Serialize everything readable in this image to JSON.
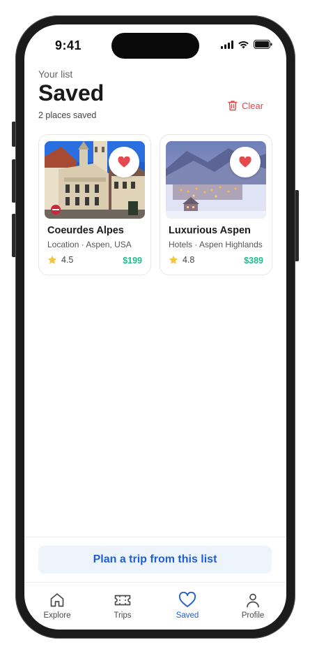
{
  "status_bar": {
    "time": "9:41"
  },
  "header": {
    "eyebrow": "Your list",
    "title": "Saved",
    "count_label": "2 places saved",
    "clear_label": "Clear"
  },
  "cards": [
    {
      "name": "Coeurdes Alpes",
      "location": "Location · Aspen, USA",
      "rating": "4.5",
      "price": "$199"
    },
    {
      "name": "Luxurious Aspen",
      "location": "Hotels · Aspen Highlands",
      "rating": "4.8",
      "price": "$389"
    }
  ],
  "plan_button": {
    "label": "Plan a trip from this list"
  },
  "tabs": [
    {
      "label": "Explore",
      "icon": "home-icon"
    },
    {
      "label": "Trips",
      "icon": "ticket-icon"
    },
    {
      "label": "Saved",
      "icon": "heart-icon"
    },
    {
      "label": "Profile",
      "icon": "person-icon"
    }
  ],
  "colors": {
    "accent": "#1f5ed6",
    "danger": "#e04848",
    "price": "#1bbd8e",
    "star": "#f4c542"
  }
}
